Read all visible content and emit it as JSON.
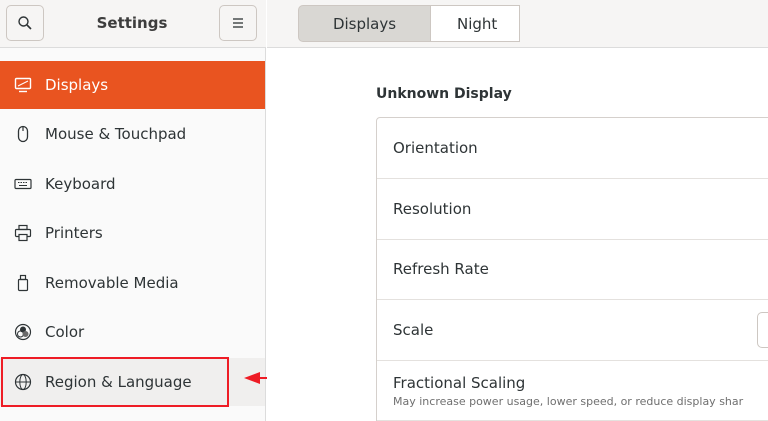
{
  "sidebar": {
    "title": "Settings",
    "items": [
      {
        "label": "Displays",
        "icon": "display-icon"
      },
      {
        "label": "Mouse & Touchpad",
        "icon": "mouse-icon"
      },
      {
        "label": "Keyboard",
        "icon": "keyboard-icon"
      },
      {
        "label": "Printers",
        "icon": "printer-icon"
      },
      {
        "label": "Removable Media",
        "icon": "removable-media-icon"
      },
      {
        "label": "Color",
        "icon": "color-icon"
      },
      {
        "label": "Region & Language",
        "icon": "globe-icon"
      }
    ],
    "active_index": 0,
    "highlighted_index": 6
  },
  "header": {
    "tabs": [
      {
        "label": "Displays",
        "selected": true
      },
      {
        "label": "Night"
      }
    ]
  },
  "main": {
    "section_title": "Unknown Display",
    "rows": [
      {
        "label": "Orientation"
      },
      {
        "label": "Resolution"
      },
      {
        "label": "Refresh Rate"
      },
      {
        "label": "Scale"
      },
      {
        "label": "Fractional Scaling",
        "subtitle": "May increase power usage, lower speed, or reduce display shar"
      }
    ]
  },
  "colors": {
    "accent": "#e95420",
    "annotation": "#ee1c25"
  }
}
